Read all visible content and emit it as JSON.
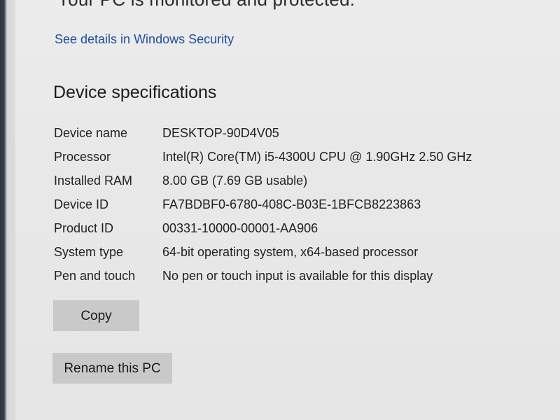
{
  "security": {
    "status_partial": "Your PC is monitored and protected.",
    "details_link": "See details in Windows Security"
  },
  "device_specs": {
    "title": "Device specifications",
    "rows": [
      {
        "label": "Device name",
        "value": "DESKTOP-90D4V05"
      },
      {
        "label": "Processor",
        "value": "Intel(R) Core(TM) i5-4300U CPU @ 1.90GHz   2.50 GHz"
      },
      {
        "label": "Installed RAM",
        "value": "8.00 GB (7.69 GB usable)"
      },
      {
        "label": "Device ID",
        "value": "FA7BDBF0-6780-408C-B03E-1BFCB8223863"
      },
      {
        "label": "Product ID",
        "value": "00331-10000-00001-AA906"
      },
      {
        "label": "System type",
        "value": "64-bit operating system, x64-based processor"
      },
      {
        "label": "Pen and touch",
        "value": "No pen or touch input is available for this display"
      }
    ],
    "copy_label": "Copy",
    "rename_label": "Rename this PC"
  }
}
